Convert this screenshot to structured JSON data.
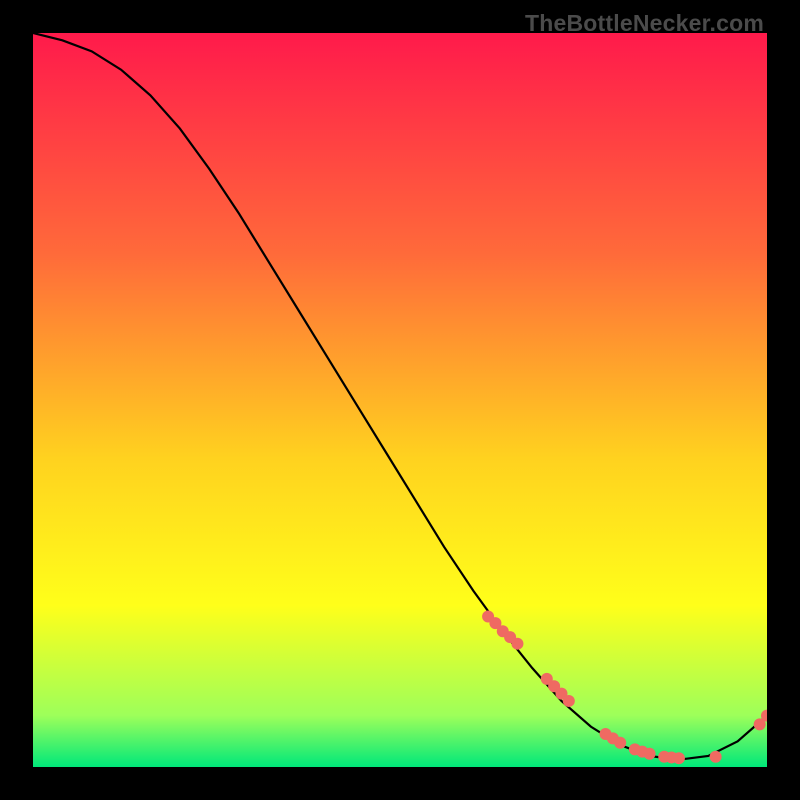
{
  "watermark": "TheBottleNecker.com",
  "colors": {
    "gradient_top": "#ff1a4b",
    "gradient_mid1": "#ff6a3a",
    "gradient_mid2": "#ffd21f",
    "gradient_mid3": "#ffff1a",
    "gradient_bottom_band": "#9dff5a",
    "gradient_bottom": "#00e87a",
    "curve": "#000000",
    "marker": "#ef6a62",
    "watermark": "#4b4b4b"
  },
  "chart_data": {
    "type": "line",
    "title": "",
    "xlabel": "",
    "ylabel": "",
    "xlim": [
      0,
      100
    ],
    "ylim": [
      0,
      100
    ],
    "curve": {
      "x": [
        0,
        4,
        8,
        12,
        16,
        20,
        24,
        28,
        32,
        36,
        40,
        44,
        48,
        52,
        56,
        60,
        64,
        68,
        72,
        76,
        80,
        84,
        88,
        92,
        96,
        100
      ],
      "y": [
        100,
        99,
        97.5,
        95,
        91.5,
        87,
        81.5,
        75.5,
        69,
        62.5,
        56,
        49.5,
        43,
        36.5,
        30,
        24,
        18.5,
        13.5,
        9,
        5.5,
        3,
        1.5,
        1,
        1.5,
        3.5,
        7
      ]
    },
    "markers": {
      "x": [
        62,
        63,
        64,
        65,
        66,
        70,
        71,
        72,
        73,
        78,
        79,
        80,
        82,
        83,
        84,
        86,
        87,
        88,
        93,
        99,
        100
      ],
      "y": [
        20.5,
        19.6,
        18.5,
        17.7,
        16.8,
        12,
        11,
        10,
        9,
        4.5,
        3.9,
        3.3,
        2.4,
        2.1,
        1.8,
        1.4,
        1.3,
        1.2,
        1.4,
        5.8,
        7
      ]
    }
  }
}
